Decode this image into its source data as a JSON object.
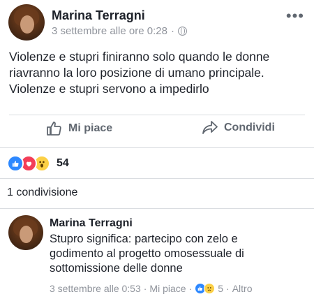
{
  "post": {
    "author": "Marina Terragni",
    "timestamp": "3 settembre alle ore 0:28",
    "separator": "·",
    "more_label": "•••",
    "text_lines": [
      "Violenze e stupri finiranno solo quando le donne",
      "riavranno la loro posizione di umano principale.",
      "Violenze e stupri servono a impedirlo"
    ]
  },
  "actions": {
    "like": "Mi piace",
    "share": "Condividi"
  },
  "reactions": {
    "types": [
      "like",
      "love",
      "wow"
    ],
    "count": "54"
  },
  "shares": {
    "label": "1 condivisione"
  },
  "comment": {
    "author": "Marina Terragni",
    "text_lines": [
      "Stupro significa: partecipo con zelo e",
      "godimento al progetto omosessuale di",
      "sottomissione delle donne"
    ],
    "timestamp": "3 settembre alle 0:53",
    "like_label": "Mi piace",
    "reaction_types": [
      "like",
      "sad"
    ],
    "reaction_count": "5",
    "more_label": "Altro",
    "separator": "·"
  },
  "colors": {
    "like_blue": "#2d88ff",
    "love_red": "#f33e58",
    "wow_yellow": "#fcd046",
    "meta_gray": "#90949c",
    "action_gray": "#606770"
  }
}
